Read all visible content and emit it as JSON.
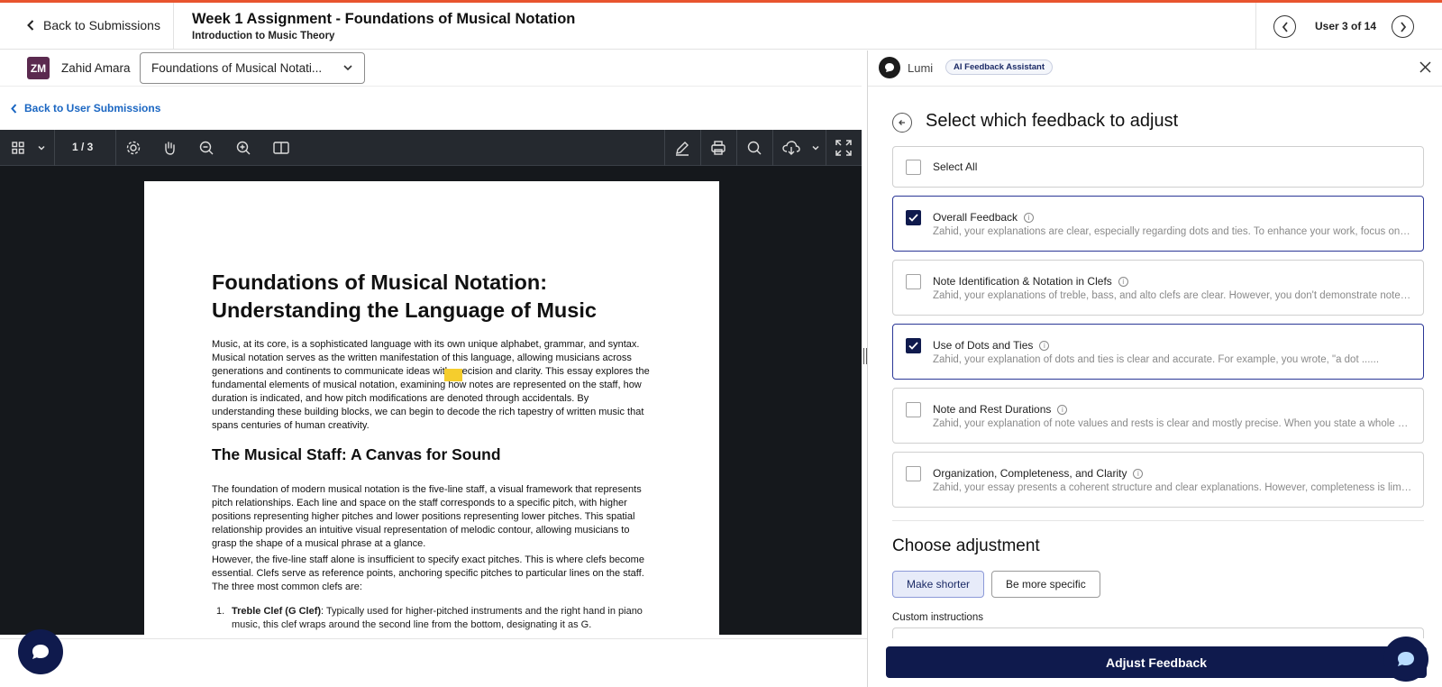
{
  "header": {
    "back_label": "Back to Submissions",
    "title": "Week 1 Assignment - Foundations of Musical Notation",
    "subtitle": "Introduction to Music Theory",
    "user_counter": "User 3 of 14"
  },
  "submission": {
    "avatar_initials": "ZM",
    "user_name": "Zahid Amara",
    "document_select": "Foundations of Musical Notati...",
    "back_to_user": "Back to User Submissions"
  },
  "viewer_toolbar": {
    "page_indicator": "1 / 3"
  },
  "document": {
    "title": "Foundations of Musical Notation: Understanding the Language of Music",
    "intro": "Music, at its core, is a sophisticated language with its own unique alphabet, grammar, and syntax. Musical notation serves as the written manifestation of this language, allowing musicians across generations and continents to communicate ideas with precision and clarity. This essay explores the fundamental elements of musical notation, examining how notes are represented on the staff, how duration is indicated, and how pitch modifications are denoted through accidentals. By understanding these building blocks, we can begin to decode the rich tapestry of written music that spans centuries of human creativity.",
    "section_heading": "The Musical Staff: A Canvas for Sound",
    "para2": "The foundation of modern musical notation is the five-line staff, a visual framework that represents pitch relationships. Each line and space on the staff corresponds to a specific pitch, with higher positions representing higher pitches and lower positions representing lower pitches. This spatial relationship provides an intuitive visual representation of melodic contour, allowing musicians to grasp the shape of a musical phrase at a glance.",
    "para3": "However, the five-line staff alone is insufficient to specify exact pitches. This is where clefs become essential. Clefs serve as reference points, anchoring specific pitches to particular lines on the staff. The three most common clefs are:",
    "list_item_1_number": "1.",
    "list_item_1_term": "Treble Clef (G Clef)",
    "list_item_1_text": ": Typically used for higher-pitched instruments and the right hand in piano music, this clef wraps around the second line from the bottom, designating it as G."
  },
  "lumi": {
    "name": "Lumi",
    "badge": "AI Feedback Assistant",
    "panel_title": "Select which feedback to adjust",
    "select_all": "Select All",
    "feedback_items": [
      {
        "label": "Overall Feedback",
        "checked": true,
        "desc": "Zahid, your explanations are clear, especially regarding dots and ties. To enhance your work, focus on adding more musical examples to strengthen your points."
      },
      {
        "label": "Note Identification & Notation in Clefs",
        "checked": false,
        "desc": "Zahid, your explanations of treble, bass, and alto clefs are clear. However, you don't demonstrate note identification on each clef with examples."
      },
      {
        "label": "Use of Dots and Ties",
        "checked": true,
        "desc": "Zahid, your explanation of dots and ties is clear and accurate. For example, you wrote, \"a dot ......"
      },
      {
        "label": "Note and Rest Durations",
        "checked": false,
        "desc": "Zahid, your explanation of note values and rests is clear and mostly precise. When you state a whole note receives four beats, note the time signature."
      },
      {
        "label": "Organization, Completeness, and Clarity",
        "checked": false,
        "desc": "Zahid, your essay presents a coherent structure and clear explanations. However, completeness is limited by missing examples of accidentals."
      }
    ],
    "adjust_title": "Choose adjustment",
    "adjustments": [
      "Make shorter",
      "Be more specific"
    ],
    "active_adjustment": "Make shorter",
    "custom_label": "Custom instructions",
    "submit_label": "Adjust Feedback"
  },
  "colors": {
    "accent_top": "#e8542e",
    "primary_navy": "#0f1a4d",
    "link_blue": "#1a66c2",
    "highlight_yellow": "#f5cd2d"
  }
}
